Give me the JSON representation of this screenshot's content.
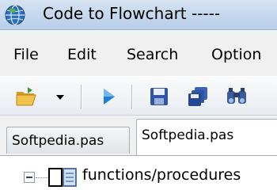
{
  "window": {
    "title": "Code to Flowchart  -----",
    "app_icon": "globe-icon"
  },
  "menu": {
    "items": [
      "File",
      "Edit",
      "Search",
      "Option"
    ]
  },
  "toolbar": {
    "buttons": [
      "open-folder-icon",
      "dropdown-arrow-icon",
      "run-icon",
      "save-icon",
      "save-all-icon",
      "find-icon"
    ]
  },
  "tabs": [
    {
      "label": "Softpedia.pas",
      "active": false
    },
    {
      "label": "Softpedia.pas",
      "active": true
    }
  ],
  "tree": {
    "root_label": "functions/procedures",
    "root_icon": "functions-node-icon"
  },
  "colors": {
    "titlebar": "#c3d6ec",
    "run_arrow": "#1e7fd8",
    "save_blue": "#2f55a4",
    "folder_yellow": "#e9b43a"
  }
}
